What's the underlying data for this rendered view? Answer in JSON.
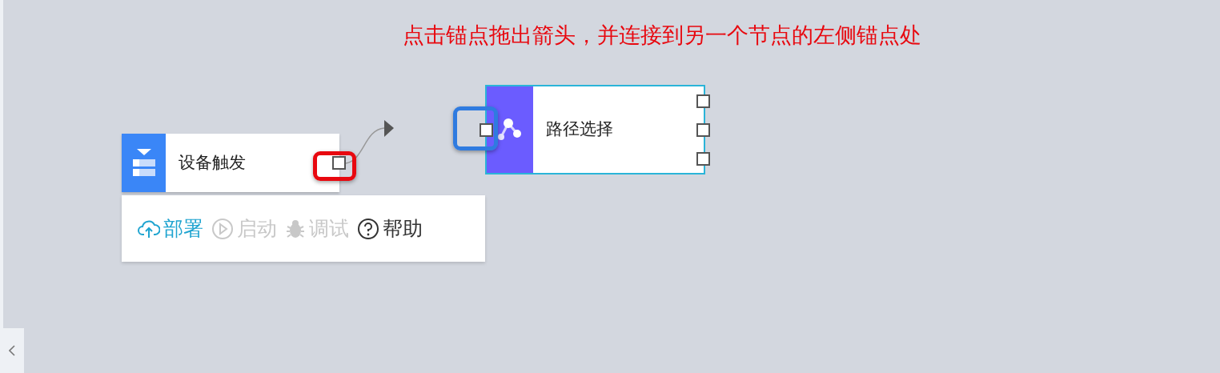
{
  "instruction": "点击锚点拖出箭头，并连接到另一个节点的左侧锚点处",
  "nodes": [
    {
      "label": "设备触发",
      "kind": "trigger",
      "color": "#3a86f7",
      "selected": false
    },
    {
      "label": "路径选择",
      "kind": "route",
      "color": "#6b5cff",
      "selected": true
    }
  ],
  "highlights": [
    {
      "color": "#e8080f"
    },
    {
      "color": "#2f7be0"
    }
  ],
  "toolbar": [
    {
      "label": "部署",
      "kind": "deploy",
      "active": true,
      "disabled": false
    },
    {
      "label": "启动",
      "kind": "start",
      "active": false,
      "disabled": true
    },
    {
      "label": "调试",
      "kind": "debug",
      "active": false,
      "disabled": true
    },
    {
      "label": "帮助",
      "kind": "help",
      "active": false,
      "disabled": false
    }
  ]
}
